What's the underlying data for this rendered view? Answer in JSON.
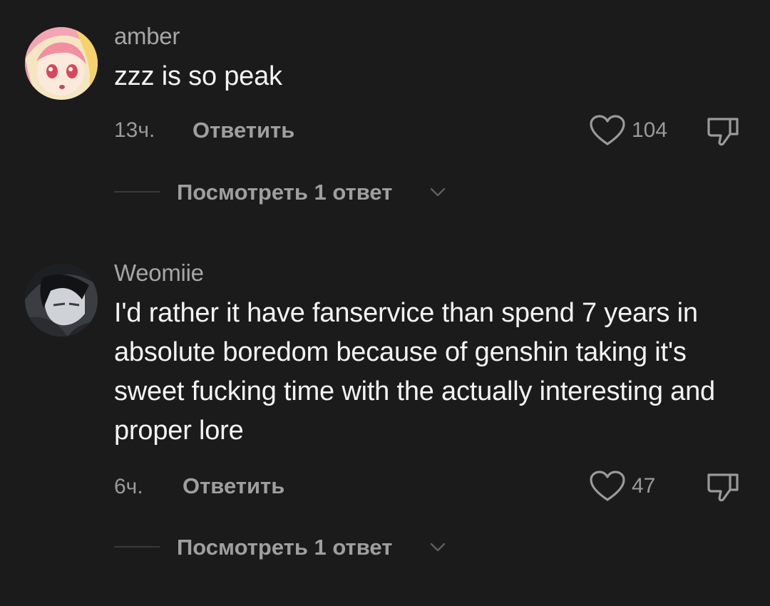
{
  "comments": [
    {
      "author": "amber",
      "text": "zzz is so peak",
      "time": "13ч.",
      "reply_label": "Ответить",
      "likes": "104",
      "view_replies": "Посмотреть 1 ответ",
      "avatar_icon": "anime-girl-avatar"
    },
    {
      "author": "Weomiie",
      "text": "I'd rather it have fanservice than spend 7 years in absolute boredom because of genshin taking it's sweet fucking time with the actually interesting and proper lore",
      "time": "6ч.",
      "reply_label": "Ответить",
      "likes": "47",
      "view_replies": "Посмотреть 1 ответ",
      "avatar_icon": "dark-anime-boy-avatar"
    }
  ],
  "icons": {
    "like": "heart-outline-icon",
    "dislike": "thumbs-down-icon",
    "expand": "chevron-down-icon"
  },
  "colors": {
    "background": "#1b1b1b",
    "primary_text": "#f4f4f4",
    "secondary_text": "#9a9a9a"
  }
}
